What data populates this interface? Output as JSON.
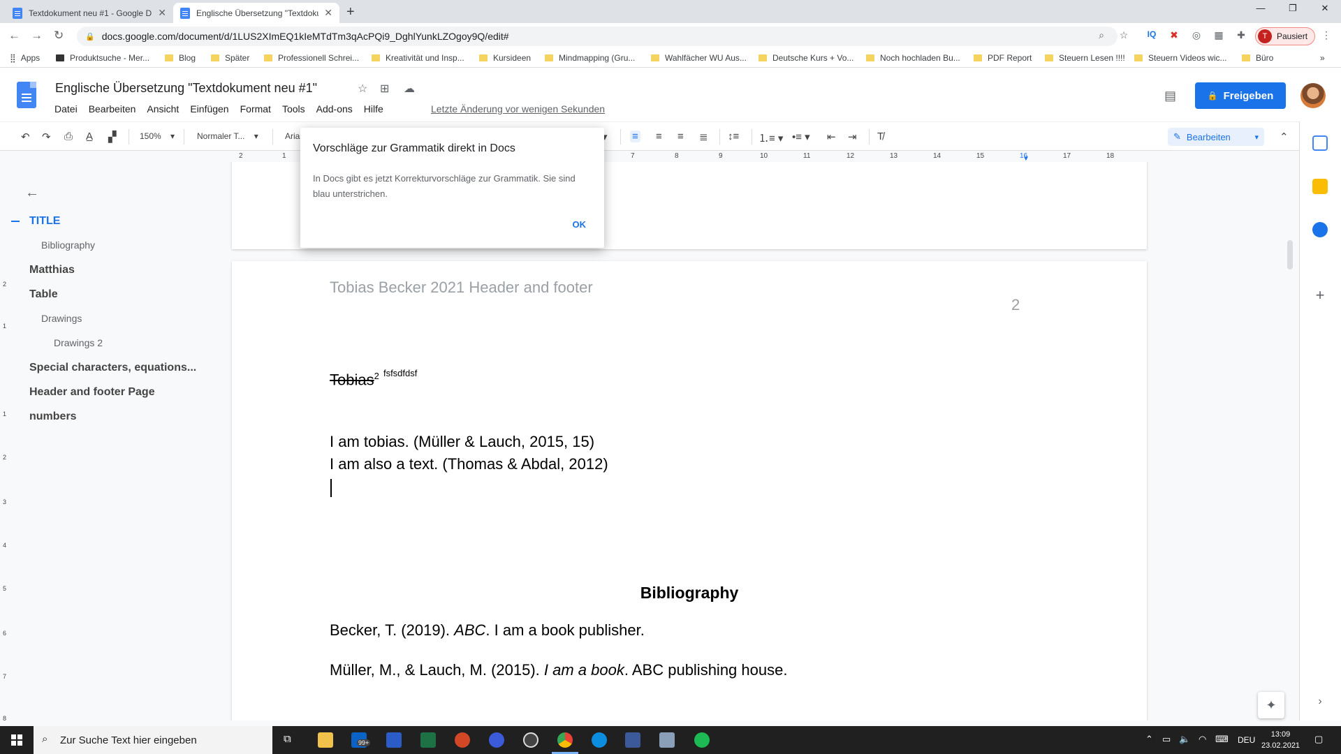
{
  "browser": {
    "tabs": [
      {
        "title": "Textdokument neu #1 - Google D",
        "active": false
      },
      {
        "title": "Englische Übersetzung \"Textdoku",
        "active": true
      }
    ],
    "url": "docs.google.com/document/d/1LUS2XImEQ1kIeMTdTm3qAcPQi9_DghlYunkLZOgoy9Q/edit#",
    "profile_label": "Pausiert",
    "profile_initial": "T",
    "bookmarks": [
      "Apps",
      "Produktsuche - Mer...",
      "Blog",
      "Später",
      "Professionell Schrei...",
      "Kreativität und Insp...",
      "Kursideen",
      "Mindmapping (Gru...",
      "Wahlfächer WU Aus...",
      "Deutsche Kurs + Vo...",
      "Noch hochladen Bu...",
      "PDF Report",
      "Steuern Lesen !!!!",
      "Steuern Videos wic...",
      "Büro"
    ]
  },
  "docs": {
    "title": "Englische Übersetzung \"Textdokument neu #1\"",
    "menu": [
      "Datei",
      "Bearbeiten",
      "Ansicht",
      "Einfügen",
      "Format",
      "Tools",
      "Add-ons",
      "Hilfe"
    ],
    "last_edit": "Letzte Änderung vor wenigen Sekunden",
    "share_label": "Freigeben",
    "toolbar": {
      "zoom": "150%",
      "style": "Normaler T...",
      "font": "Aria",
      "edit_mode": "Bearbeiten"
    },
    "ruler": [
      "2",
      "1",
      "7",
      "8",
      "9",
      "10",
      "11",
      "12",
      "13",
      "14",
      "15",
      "16",
      "17",
      "18"
    ],
    "left_ruler": [
      "2",
      "1",
      "1",
      "2",
      "3",
      "4",
      "5",
      "6",
      "7",
      "8"
    ]
  },
  "outline": [
    {
      "label": "TITLE",
      "level": 1,
      "active": true
    },
    {
      "label": "Bibliography",
      "level": 2
    },
    {
      "label": "Matthias",
      "level": 1
    },
    {
      "label": "Table",
      "level": 1
    },
    {
      "label": "Drawings",
      "level": 2
    },
    {
      "label": "Drawings 2",
      "level": 3
    },
    {
      "label": "Special characters, equations...",
      "level": 1
    },
    {
      "label": "Header and footer Page",
      "level": 1
    },
    {
      "label": "numbers",
      "level": 1
    }
  ],
  "page": {
    "header_text": "Tobias Becker 2021 Header and footer",
    "page_number": "2",
    "strike_word": "Tobias",
    "superscript": "2",
    "super_tail": "fsfsdfdsf",
    "line1": "I am tobias. (Müller & Lauch, 2015, 15)",
    "line2": "I am also a text. (Thomas & Abdal, 2012)",
    "bibliography_heading": "Bibliography",
    "bib1_pre": "Becker, T. (2019). ",
    "bib1_italic": "ABC",
    "bib1_post": ". I am a book publisher.",
    "bib2_pre": "Müller, M., & Lauch, M. (2015). ",
    "bib2_italic": "I am a book",
    "bib2_post": ". ABC publishing house."
  },
  "dialog": {
    "title": "Vorschläge zur Grammatik direkt in Docs",
    "body": "In Docs gibt es jetzt Korrekturvorschläge zur Grammatik. Sie sind blau unterstrichen.",
    "ok": "OK"
  },
  "taskbar": {
    "search_placeholder": "Zur Suche Text hier eingeben",
    "mail_badge": "99+",
    "lang": "DEU",
    "time": "13:09",
    "date": "23.02.2021"
  }
}
